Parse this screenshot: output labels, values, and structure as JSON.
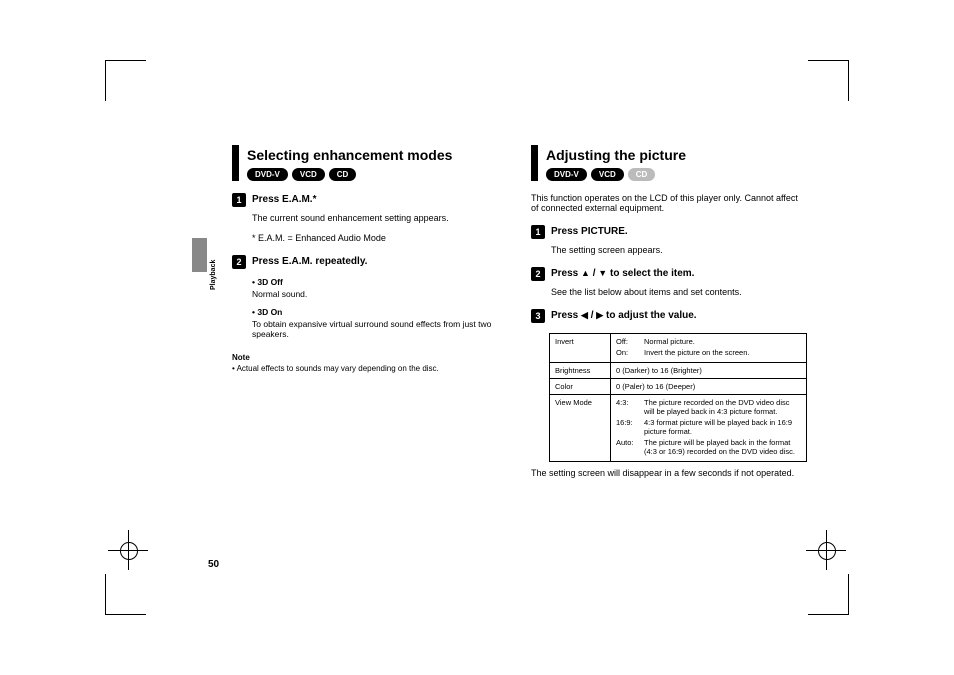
{
  "sideLabel": "Playback",
  "pageNumber": "50",
  "left": {
    "title": "Selecting enhancement modes",
    "badges": [
      "DVD-V",
      "VCD",
      "CD"
    ],
    "step1": {
      "num": "1",
      "head": "Press E.A.M.*",
      "body": "The current sound enhancement setting appears.",
      "footnote": "* E.A.M. = Enhanced Audio Mode"
    },
    "step2": {
      "num": "2",
      "head": "Press E.A.M. repeatedly.",
      "b1head": "• 3D Off",
      "b1text": "Normal sound.",
      "b2head": "• 3D On",
      "b2text": "To obtain expansive virtual surround sound effects from just two speakers."
    },
    "noteHead": "Note",
    "noteText": "• Actual effects to sounds may vary depending on the disc."
  },
  "right": {
    "title": "Adjusting the picture",
    "badges": [
      "DVD-V",
      "VCD",
      "CD"
    ],
    "intro": "This function operates on the LCD of this player only. Cannot affect of connected external equipment.",
    "step1": {
      "num": "1",
      "head": "Press PICTURE.",
      "body": "The setting screen appears."
    },
    "step2": {
      "num": "2",
      "headPrefix": "Press ",
      "headSuffix": " to select the item.",
      "body": "See the list below about items and set contents."
    },
    "step3": {
      "num": "3",
      "headPrefix": "Press ",
      "headSuffix": " to adjust the value."
    },
    "table": {
      "r1k": "Invert",
      "r1a": "Off:",
      "r1av": "Normal picture.",
      "r1b": "On:",
      "r1bv": "Invert the picture on the screen.",
      "r2k": "Brightness",
      "r2v": "0 (Darker) to 16 (Brighter)",
      "r3k": "Color",
      "r3v": "0 (Paler) to 16 (Deeper)",
      "r4k": "View Mode",
      "r4a": "4:3:",
      "r4av": "The picture recorded on the DVD video disc will be played back in 4:3 picture format.",
      "r4b": "16:9:",
      "r4bv": "4:3 format picture will be played back in 16:9 picture format.",
      "r4c": "Auto:",
      "r4cv": "The picture will be played back in the format (4:3 or 16:9) recorded on the DVD video disc."
    },
    "closing": "The setting screen will disappear in a few seconds if not operated."
  }
}
